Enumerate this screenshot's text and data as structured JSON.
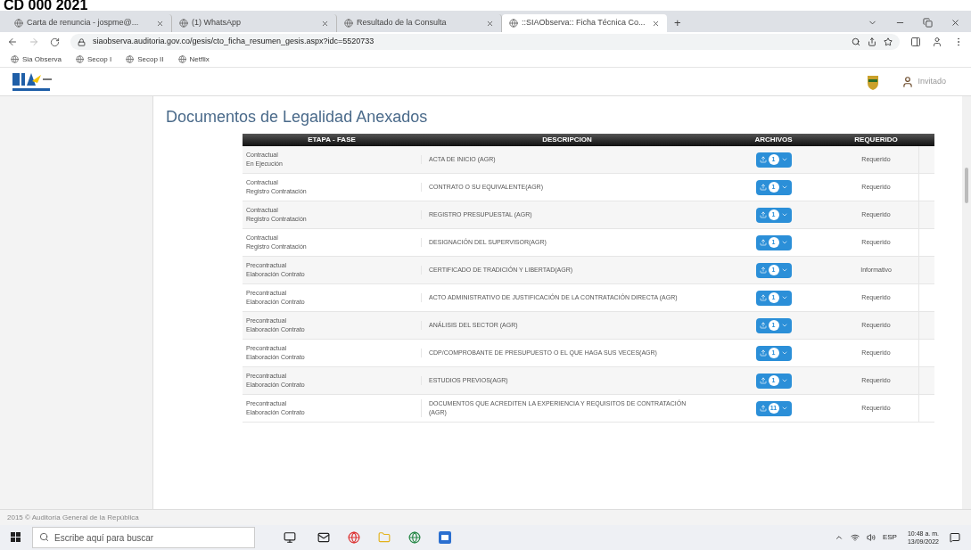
{
  "overlay_title": "CD 000 2021",
  "browser": {
    "tabs": [
      {
        "title": "Carta de renuncia - jospme@...",
        "selected": false
      },
      {
        "title": "(1) WhatsApp",
        "selected": false
      },
      {
        "title": "Resultado de la Consulta",
        "selected": false
      },
      {
        "title": "::SIAObserva:: Ficha Técnica Co...",
        "selected": true
      }
    ],
    "new_tab": "+",
    "url": "siaobserva.auditoria.gov.co/gesis/cto_ficha_resumen_gesis.aspx?idc=5520733",
    "bookmarks": [
      "Sia Observa",
      "Secop I",
      "Secop II",
      "Netflix"
    ]
  },
  "header": {
    "user": "Invitado"
  },
  "section_title": "Documentos de Legalidad Anexados",
  "table": {
    "columns": [
      "ETAPA - FASE",
      "DESCRIPCION",
      "ARCHIVOS",
      "REQUERIDO"
    ],
    "rows": [
      {
        "stage": "Contractual",
        "phase": "En Ejecución",
        "description": "ACTA DE INICIO (AGR)",
        "files": "1",
        "required": "Requerido"
      },
      {
        "stage": "Contractual",
        "phase": "Registro Contratación",
        "description": "CONTRATO O SU EQUIVALENTE(AGR)",
        "files": "1",
        "required": "Requerido"
      },
      {
        "stage": "Contractual",
        "phase": "Registro Contratación",
        "description": "REGISTRO PRESUPUESTAL (AGR)",
        "files": "1",
        "required": "Requerido"
      },
      {
        "stage": "Contractual",
        "phase": "Registro Contratación",
        "description": "DESIGNACIÓN DEL SUPERVISOR(AGR)",
        "files": "1",
        "required": "Requerido"
      },
      {
        "stage": "Precontractual",
        "phase": "Elaboración Contrato",
        "description": "CERTIFICADO DE TRADICIÓN Y LIBERTAD(AGR)",
        "files": "1",
        "required": "Informativo"
      },
      {
        "stage": "Precontractual",
        "phase": "Elaboración Contrato",
        "description": "ACTO ADMINISTRATIVO DE JUSTIFICACIÓN DE LA CONTRATACIÓN DIRECTA (AGR)",
        "files": "1",
        "required": "Requerido"
      },
      {
        "stage": "Precontractual",
        "phase": "Elaboración Contrato",
        "description": "ANÁLISIS DEL SECTOR (AGR)",
        "files": "1",
        "required": "Requerido"
      },
      {
        "stage": "Precontractual",
        "phase": "Elaboración Contrato",
        "description": "CDP/COMPROBANTE DE PRESUPUESTO O EL QUE HAGA SUS VECES(AGR)",
        "files": "1",
        "required": "Requerido"
      },
      {
        "stage": "Precontractual",
        "phase": "Elaboración Contrato",
        "description": "ESTUDIOS PREVIOS(AGR)",
        "files": "1",
        "required": "Requerido"
      },
      {
        "stage": "Precontractual",
        "phase": "Elaboración Contrato",
        "description": "DOCUMENTOS QUE ACREDITEN LA EXPERIENCIA Y REQUISITOS DE CONTRATACIÓN (AGR)",
        "files": "11",
        "required": "Requerido"
      }
    ]
  },
  "footer": "2015 © Auditoría General de la República",
  "taskbar": {
    "search_placeholder": "Escribe aquí para buscar",
    "language": "ESP",
    "time": "10:48 a. m.",
    "date": "13/09/2022"
  }
}
